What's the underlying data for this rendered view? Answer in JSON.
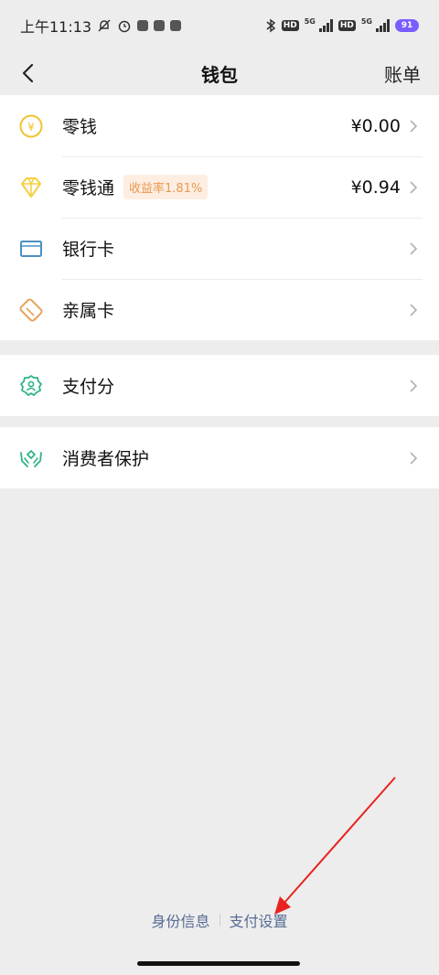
{
  "status_bar": {
    "time": "上午11:13",
    "network_1": "5G",
    "network_2": "5G",
    "hd_1": "HD",
    "hd_2": "HD",
    "battery": "91"
  },
  "nav": {
    "title": "钱包",
    "right_label": "账单"
  },
  "wallet_items": [
    {
      "label": "零钱",
      "value": "¥0.00",
      "icon": "coin-icon"
    },
    {
      "label": "零钱通",
      "badge": "收益率1.81%",
      "value": "¥0.94",
      "icon": "diamond-icon"
    },
    {
      "label": "银行卡",
      "icon": "bank-card-icon"
    },
    {
      "label": "亲属卡",
      "icon": "family-card-icon"
    }
  ],
  "score_items": [
    {
      "label": "支付分",
      "icon": "pay-score-icon"
    }
  ],
  "protect_items": [
    {
      "label": "消费者保护",
      "icon": "protect-hands-icon"
    }
  ],
  "footer": {
    "identity_link": "身份信息",
    "pay_settings_link": "支付设置"
  },
  "colors": {
    "background": "#ededed",
    "link": "#576b95",
    "badge_bg": "#fdeee1",
    "badge_text": "#e79a52",
    "coin": "#f1c232",
    "diamond": "#f4d03f",
    "bank_card": "#4a90c2",
    "family_card": "#e8a25a",
    "green": "#2fb385",
    "annotation_arrow": "#e8231e"
  }
}
